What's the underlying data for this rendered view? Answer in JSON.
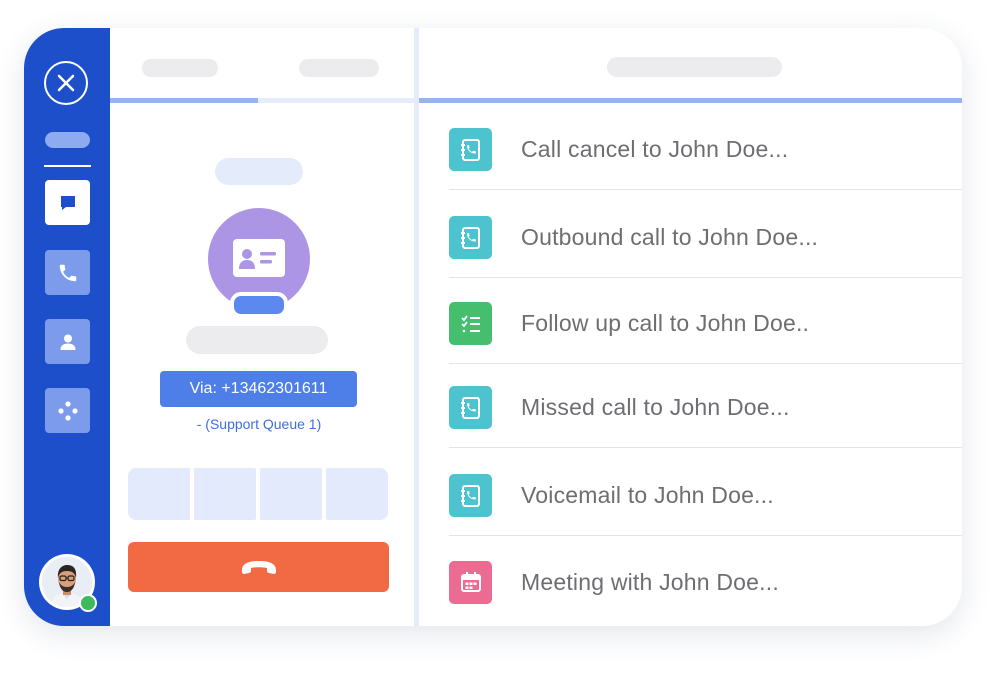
{
  "contact": {
    "via_label": "Via: +13462301611",
    "queue_label": "- (Support Queue 1)"
  },
  "activities": [
    {
      "label": "Call cancel to John Doe...",
      "icon": "phone-book-icon",
      "color": "#4cc3ce"
    },
    {
      "label": "Outbound call to John Doe...",
      "icon": "phone-book-icon",
      "color": "#4cc3ce"
    },
    {
      "label": "Follow up call to John Doe..",
      "icon": "checklist-icon",
      "color": "#45be6e"
    },
    {
      "label": "Missed call to John Doe...",
      "icon": "phone-book-icon",
      "color": "#4cc3ce"
    },
    {
      "label": "Voicemail to John Doe...",
      "icon": "phone-book-icon",
      "color": "#4cc3ce"
    },
    {
      "label": "Meeting with John Doe...",
      "icon": "calendar-icon",
      "color": "#ec6b93"
    }
  ],
  "colors": {
    "sidebar": "#1e4fcb",
    "accent": "#4e7fe8",
    "hangup": "#f26a43",
    "contact_avatar": "#ad95e5",
    "online": "#3dbb5c"
  }
}
